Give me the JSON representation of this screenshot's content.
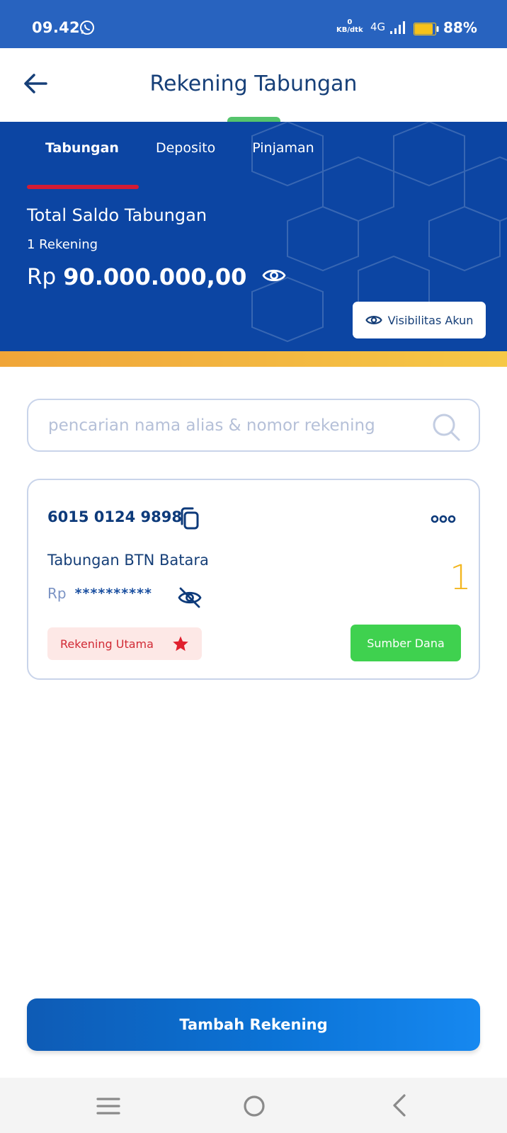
{
  "status_bar": {
    "time": "09.42",
    "net_speed_value": "0",
    "net_speed_unit": "KB/dtk",
    "network_type": "4G",
    "battery_percent": "88%",
    "battery_level": 0.88,
    "icons": [
      "whatsapp-icon",
      "signal-icon",
      "battery-icon"
    ]
  },
  "header": {
    "title": "Rekening Tabungan",
    "back_icon": "arrow-left-icon"
  },
  "tabs": [
    {
      "label": "Tabungan",
      "active": true
    },
    {
      "label": "Deposito",
      "active": false
    },
    {
      "label": "Pinjaman",
      "active": false
    }
  ],
  "summary": {
    "title": "Total Saldo Tabungan",
    "account_count": "1 Rekening",
    "currency": "Rp",
    "amount": "90.000.000,00",
    "visibility_button": "Visibilitas Akun"
  },
  "search": {
    "placeholder": "pencarian nama alias & nomor rekening",
    "value": ""
  },
  "account": {
    "number": "6015 0124 9898",
    "name": "Tabungan BTN Batara",
    "badge_number": "1",
    "currency": "Rp",
    "masked_balance": "**********",
    "primary_label": "Rekening Utama",
    "source_button": "Sumber Dana"
  },
  "actions": {
    "add_account": "Tambah Rekening"
  },
  "colors": {
    "primary_blue": "#0c45a3",
    "status_blue": "#2863bf",
    "accent_red": "#d31b35",
    "accent_gold": "#f3b61f",
    "success_green": "#3fd14f"
  }
}
